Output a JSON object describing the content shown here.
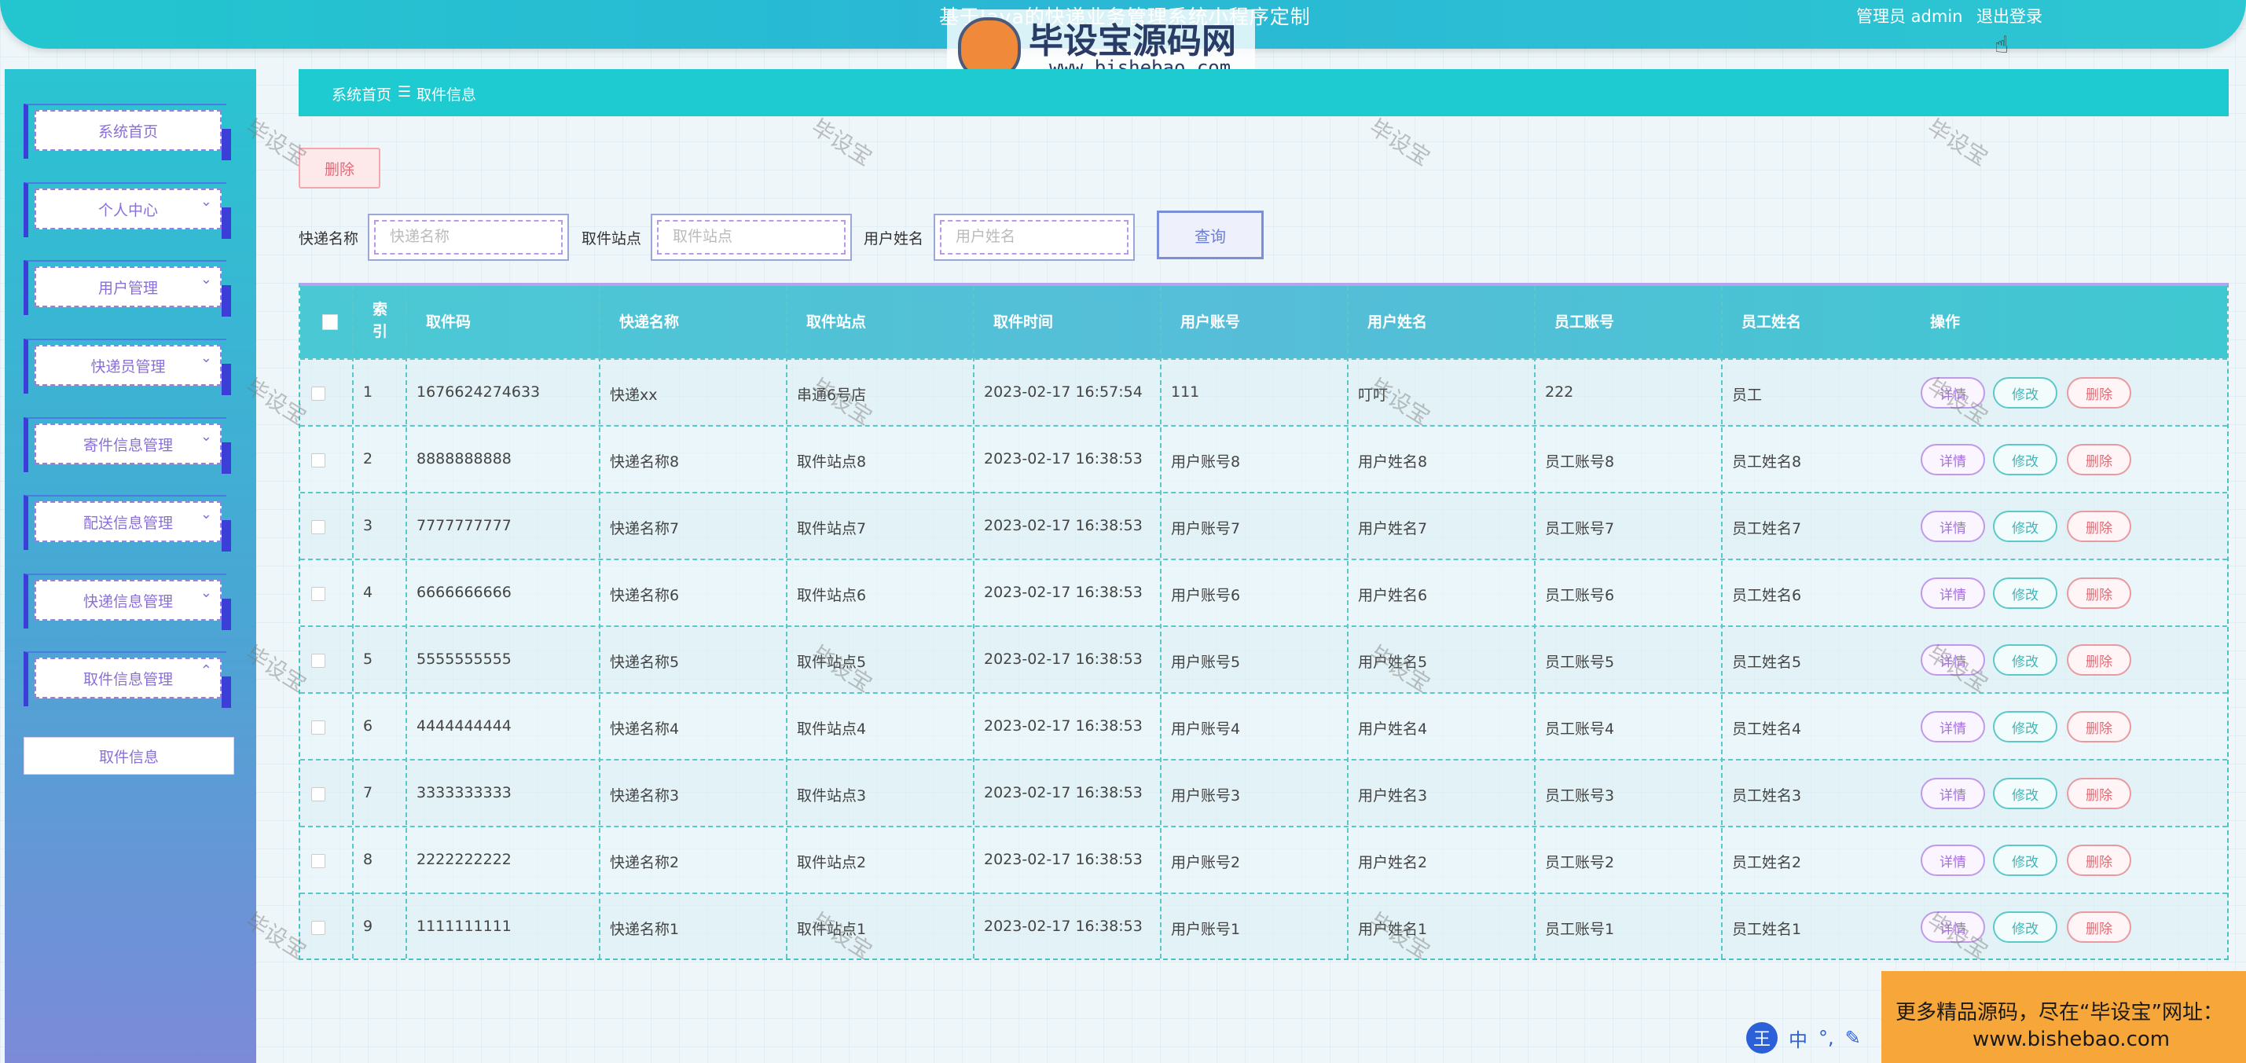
{
  "header": {
    "title": "基于Java的快递业务管理系统小程序定制",
    "admin": "管理员 admin",
    "logout": "退出登录"
  },
  "watermark": {
    "brand": "毕设宝源码网",
    "url": "www.bishebao.com",
    "stamp": "毕设宝"
  },
  "sidebar": {
    "items": [
      {
        "label": "系统首页",
        "expandable": false
      },
      {
        "label": "个人中心",
        "expandable": true
      },
      {
        "label": "用户管理",
        "expandable": true
      },
      {
        "label": "快递员管理",
        "expandable": true
      },
      {
        "label": "寄件信息管理",
        "expandable": true
      },
      {
        "label": "配送信息管理",
        "expandable": true
      },
      {
        "label": "快递信息管理",
        "expandable": true
      },
      {
        "label": "取件信息管理",
        "expandable": true,
        "expanded": true
      }
    ],
    "sub_item": "取件信息"
  },
  "breadcrumb": {
    "home": "系统首页",
    "sep": "☰",
    "current": "取件信息"
  },
  "toolbar": {
    "delete_label": "删除"
  },
  "search": {
    "label1": "快递名称",
    "placeholder1": "快递名称",
    "label2": "取件站点",
    "placeholder2": "取件站点",
    "label3": "用户姓名",
    "placeholder3": "用户姓名",
    "query_label": "查询"
  },
  "table": {
    "headers": [
      "索引",
      "取件码",
      "快递名称",
      "取件站点",
      "取件时间",
      "用户账号",
      "用户姓名",
      "员工账号",
      "员工姓名",
      "操作"
    ],
    "index_header_line1": "索",
    "index_header_line2": "引",
    "actions": {
      "detail": "详情",
      "edit": "修改",
      "delete": "删除"
    },
    "rows": [
      [
        "1",
        "1676624274633",
        "快递xx",
        "串通6号店",
        "2023-02-17 16:57:54",
        "111",
        "叮叮",
        "222",
        "员工"
      ],
      [
        "2",
        "8888888888",
        "快递名称8",
        "取件站点8",
        "2023-02-17 16:38:53",
        "用户账号8",
        "用户姓名8",
        "员工账号8",
        "员工姓名8"
      ],
      [
        "3",
        "7777777777",
        "快递名称7",
        "取件站点7",
        "2023-02-17 16:38:53",
        "用户账号7",
        "用户姓名7",
        "员工账号7",
        "员工姓名7"
      ],
      [
        "4",
        "6666666666",
        "快递名称6",
        "取件站点6",
        "2023-02-17 16:38:53",
        "用户账号6",
        "用户姓名6",
        "员工账号6",
        "员工姓名6"
      ],
      [
        "5",
        "5555555555",
        "快递名称5",
        "取件站点5",
        "2023-02-17 16:38:53",
        "用户账号5",
        "用户姓名5",
        "员工账号5",
        "员工姓名5"
      ],
      [
        "6",
        "4444444444",
        "快递名称4",
        "取件站点4",
        "2023-02-17 16:38:53",
        "用户账号4",
        "用户姓名4",
        "员工账号4",
        "员工姓名4"
      ],
      [
        "7",
        "3333333333",
        "快递名称3",
        "取件站点3",
        "2023-02-17 16:38:53",
        "用户账号3",
        "用户姓名3",
        "员工账号3",
        "员工姓名3"
      ],
      [
        "8",
        "2222222222",
        "快递名称2",
        "取件站点2",
        "2023-02-17 16:38:53",
        "用户账号2",
        "用户姓名2",
        "员工账号2",
        "员工姓名2"
      ],
      [
        "9",
        "1111111111",
        "快递名称1",
        "取件站点1",
        "2023-02-17 16:38:53",
        "用户账号1",
        "用户姓名1",
        "员工账号1",
        "员工姓名1"
      ]
    ]
  },
  "ad": {
    "line1": "更多精品源码，尽在“毕设宝”网址：",
    "line2": "www.bishebao.com"
  },
  "ime": {
    "badge": "王",
    "mode": "中"
  },
  "colors": {
    "accent": "#1ecbd1",
    "sidebar_border": "#3b3fd8",
    "detail": "#a46fe0",
    "edit": "#3fb6b8",
    "delete": "#e06b76"
  }
}
